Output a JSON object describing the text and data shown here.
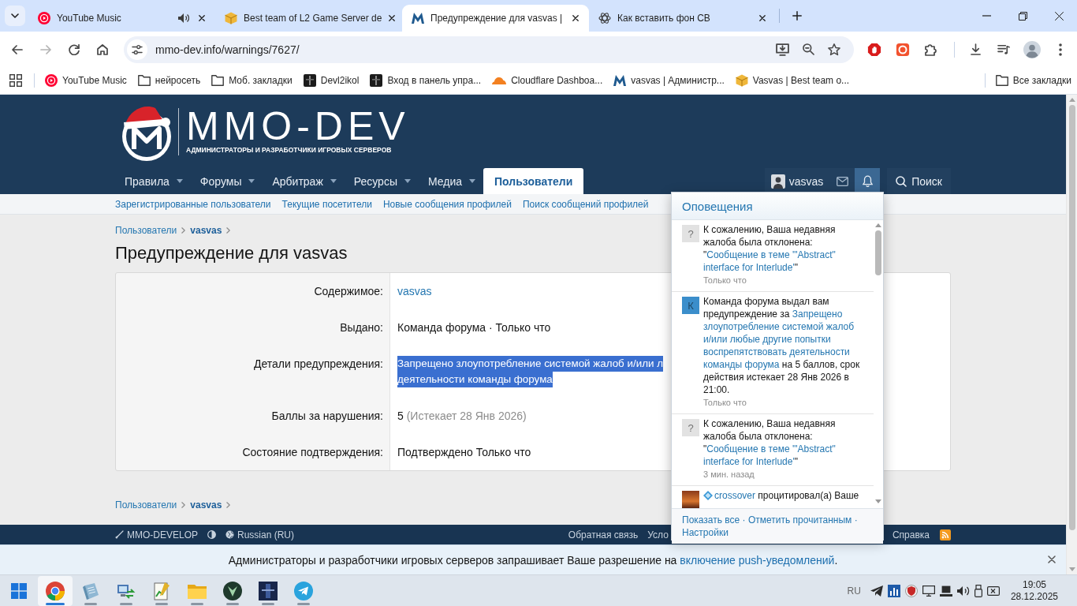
{
  "browser": {
    "tabs": [
      {
        "kind": "music",
        "title": "YouTube Music",
        "audio": true,
        "selected": false
      },
      {
        "kind": "box",
        "title": "Best team of L2 Game Server de",
        "audio": false,
        "selected": false
      },
      {
        "kind": "forum",
        "title": "Предупреждение для vasvas |",
        "audio": false,
        "selected": true
      },
      {
        "kind": "knot",
        "title": "Как вставить фон СВ",
        "audio": false,
        "selected": false
      }
    ],
    "nav_buttons": [
      {
        "kind": "back",
        "disabled": false
      },
      {
        "kind": "forward",
        "disabled": true
      },
      {
        "kind": "reload",
        "disabled": false
      },
      {
        "kind": "home",
        "disabled": false
      }
    ],
    "address": "mmo-dev.info/warnings/7627/",
    "bookmarks": [
      {
        "kind": "music",
        "label": "YouTube Music"
      },
      {
        "kind": "folder",
        "label": "нейросеть"
      },
      {
        "kind": "folder",
        "label": "Моб. закладки"
      },
      {
        "kind": "game",
        "label": "Devl2ikol"
      },
      {
        "kind": "game",
        "label": "Вход в панель упра..."
      },
      {
        "kind": "cloud",
        "label": "Cloudflare Dashboa..."
      },
      {
        "kind": "forum",
        "label": "vasvas | Администр..."
      },
      {
        "kind": "box",
        "label": "Vasvas | Best team o..."
      }
    ],
    "all_bookmarks": "Все закладки"
  },
  "site": {
    "logo": {
      "title": "MMO-DEV",
      "subtitle": "АДМИНИСТРАТОРЫ И РАЗРАБОТЧИКИ ИГРОВЫХ СЕРВЕРОВ"
    },
    "nav": [
      {
        "label": "Правила",
        "dropdown": true,
        "selected": false
      },
      {
        "label": "Форумы",
        "dropdown": true,
        "selected": false
      },
      {
        "label": "Арбитраж",
        "dropdown": true,
        "selected": false
      },
      {
        "label": "Ресурсы",
        "dropdown": true,
        "selected": false
      },
      {
        "label": "Медиа",
        "dropdown": true,
        "selected": false
      },
      {
        "label": "Пользователи",
        "dropdown": false,
        "selected": true
      }
    ],
    "account": {
      "username": "vasvas"
    },
    "nav_icons": [
      {
        "kind": "conversations",
        "selected": false
      },
      {
        "kind": "alerts",
        "selected": true
      }
    ],
    "search": {
      "label": "Поиск"
    },
    "subnav": [
      "Зарегистрированные пользователи",
      "Текущие посетители",
      "Новые сообщения профилей",
      "Поиск сообщений профилей"
    ]
  },
  "page": {
    "breadcrumb_top": [
      {
        "label": "Пользователи",
        "current": false
      },
      {
        "label": "vasvas",
        "current": true
      }
    ],
    "title": "Предупреждение для vasvas",
    "rows": [
      {
        "label": "Содержимое:",
        "kind": "link",
        "value": "vasvas",
        "selected": false
      },
      {
        "label": "Выдано:",
        "kind": "text",
        "value": "Команда форума · Только что",
        "selected": false
      },
      {
        "label": "Детали предупреждения:",
        "kind": "lines",
        "lines": [
          "Запрещено злоупотребление системой жалоб и/или л",
          "деятельности команды форума"
        ],
        "selected": true
      },
      {
        "label": "Баллы за нарушения:",
        "kind": "points",
        "value": "5",
        "note": "(Истекает 28 Янв 2026)",
        "selected": false
      },
      {
        "label": "Состояние подтверждения:",
        "kind": "text",
        "value": "Подтверждено Только что",
        "selected": false
      }
    ],
    "breadcrumb_bottom": [
      {
        "label": "Пользователи",
        "current": false
      },
      {
        "label": "vasvas",
        "current": true
      }
    ]
  },
  "footer": {
    "left": [
      {
        "kind": "style",
        "label": "MMO-DEVELOP"
      },
      {
        "kind": "theme"
      },
      {
        "kind": "language",
        "label": "Russian (RU)"
      }
    ],
    "links": [
      "Обратная связь",
      "Усло"
    ],
    "links_end": [
      "Справка"
    ]
  },
  "notifications": {
    "title": "Оповещения",
    "items": [
      {
        "avatar": {
          "kind": "letter",
          "letter": "?",
          "color": "#e2e2e2"
        },
        "lines": [
          [
            {
              "kind": "text",
              "text": "К сожалению, Ваша недавняя"
            }
          ],
          [
            {
              "kind": "text",
              "text": "жалоба была отклонена:"
            }
          ],
          [
            {
              "kind": "text",
              "text": "\""
            },
            {
              "kind": "link",
              "text": "Сообщение в теме '\"Abstract\""
            }
          ],
          [
            {
              "kind": "link",
              "text": "interface for Interlude'"
            },
            {
              "kind": "text",
              "text": "\""
            }
          ]
        ],
        "time": "Только что"
      },
      {
        "avatar": {
          "kind": "letter",
          "letter": "К",
          "color": "#3b8ecb"
        },
        "lines": [
          [
            {
              "kind": "text",
              "text": "Команда форума выдал вам"
            }
          ],
          [
            {
              "kind": "text",
              "text": "предупреждение за "
            },
            {
              "kind": "link",
              "text": "Запрещено"
            }
          ],
          [
            {
              "kind": "link",
              "text": "злоупотребление системой жалоб"
            }
          ],
          [
            {
              "kind": "link",
              "text": "и/или любые другие попытки"
            }
          ],
          [
            {
              "kind": "link",
              "text": "воспрепятствовать деятельности"
            }
          ],
          [
            {
              "kind": "link",
              "text": "команды форума"
            },
            {
              "kind": "text",
              "text": " на 5 баллов, срок"
            }
          ],
          [
            {
              "kind": "text",
              "text": "действия истекает 28 Янв 2026 в"
            }
          ],
          [
            {
              "kind": "text",
              "text": "21:00."
            }
          ]
        ],
        "time": "Только что"
      },
      {
        "avatar": {
          "kind": "letter",
          "letter": "?",
          "color": "#e2e2e2"
        },
        "lines": [
          [
            {
              "kind": "text",
              "text": "К сожалению, Ваша недавняя"
            }
          ],
          [
            {
              "kind": "text",
              "text": "жалоба была отклонена:"
            }
          ],
          [
            {
              "kind": "text",
              "text": "\""
            },
            {
              "kind": "link",
              "text": "Сообщение в теме '\"Abstract\""
            }
          ],
          [
            {
              "kind": "link",
              "text": "interface for Interlude'"
            },
            {
              "kind": "text",
              "text": "\""
            }
          ]
        ],
        "time": "3 мин. назад"
      },
      {
        "avatar": {
          "kind": "photo"
        },
        "lines": [
          [
            {
              "kind": "icon"
            },
            {
              "kind": "link",
              "text": "crossover"
            },
            {
              "kind": "text",
              "text": " процитировал(а) Ваше"
            }
          ]
        ]
      }
    ],
    "footer_links": [
      "Показать все",
      "Отметить прочитанным",
      "Настройки"
    ],
    "separator": "·"
  },
  "push_prompt": {
    "text": "Администраторы и разработчики игровых серверов запрашивает Ваше разрешение на",
    "link": "включение push-уведомлений",
    "end": "."
  },
  "taskbar": {
    "apps": [
      {
        "kind": "chrome",
        "running": true,
        "selected": true
      },
      {
        "kind": "notebook",
        "running": true,
        "selected": false
      },
      {
        "kind": "network",
        "running": true,
        "selected": false
      },
      {
        "kind": "chart",
        "running": true,
        "selected": false
      },
      {
        "kind": "folder",
        "running": true,
        "selected": false
      },
      {
        "kind": "emblem",
        "running": true,
        "selected": false
      },
      {
        "kind": "dark",
        "running": true,
        "selected": false
      },
      {
        "kind": "telegram",
        "running": true,
        "selected": false
      }
    ],
    "language": "RU",
    "time": "19:05",
    "date": "28.12.2025"
  }
}
